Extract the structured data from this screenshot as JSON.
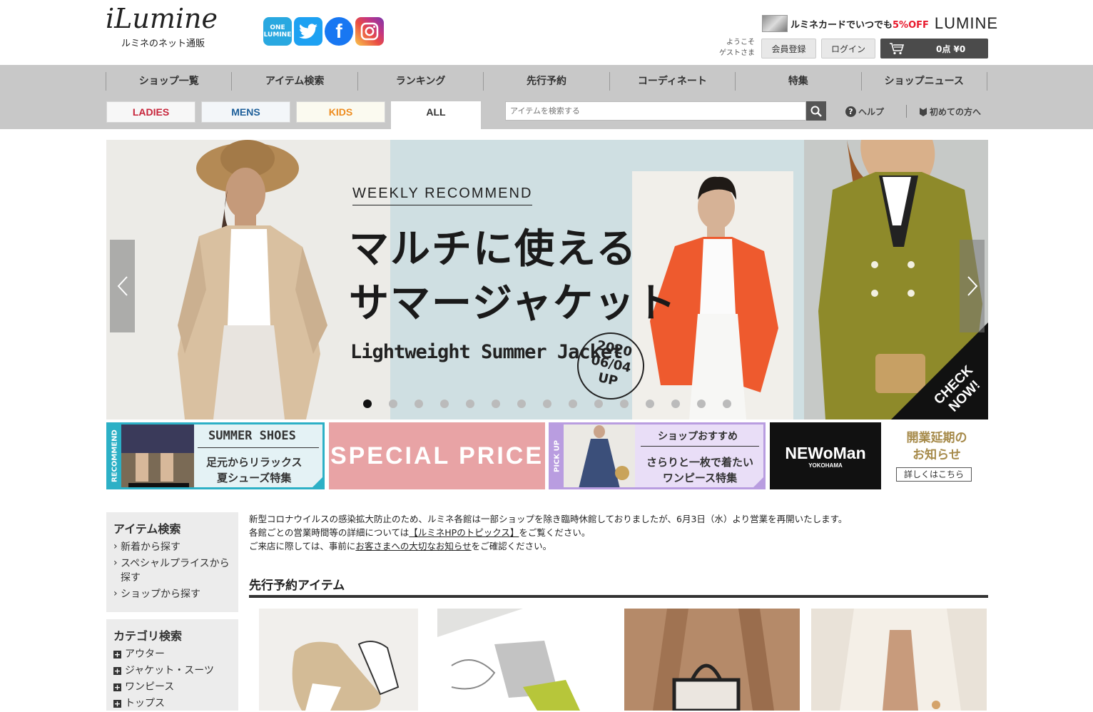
{
  "header": {
    "logo": "iLumine",
    "logo_sub": "ルミネのネット通販",
    "social": {
      "one_lumine": "ONE LUMINE"
    },
    "promo_text_pre": "ルミネカードでいつでも",
    "promo_text_off": "5%OFF",
    "promo_brand": "LUMINE",
    "welcome_line1": "ようこそ",
    "welcome_line2": "ゲストさま",
    "register": "会員登録",
    "login": "ログイン",
    "cart": "0点 ¥0"
  },
  "nav": {
    "items": [
      "ショップ一覧",
      "アイテム検索",
      "ランキング",
      "先行予約",
      "コーディネート",
      "特集",
      "ショップニュース"
    ],
    "tabs": {
      "ladies": "LADIES",
      "mens": "MENS",
      "kids": "KIDS",
      "all": "ALL"
    },
    "search_placeholder": "アイテムを検索する",
    "help": "ヘルプ",
    "first_time": "初めての方へ"
  },
  "hero": {
    "weekly": "WEEKLY RECOMMEND",
    "headline1": "マルチに使える",
    "headline2": "サマージャケット",
    "subline": "Lightweight Summer Jacket",
    "date_year": "2020",
    "date_day": "06/04",
    "date_up": "UP",
    "check1": "CHECK",
    "check2": "NOW!",
    "dot_count": 15,
    "active_dot": 1
  },
  "banners": {
    "b1_vert": "RECOMMEND",
    "b1_title": "SUMMER SHOES",
    "b1_line1": "足元からリラックス",
    "b1_line2": "夏シューズ特集",
    "b2_title": "SPECIAL PRICE",
    "b3_vert": "PICK UP",
    "b3_title": "ショップおすすめ",
    "b3_line1": "さらりと一枚で着たい",
    "b3_line2": "ワンピース特集",
    "b4_title": "NEWoMan",
    "b4_sub": "YOKOHAMA",
    "b5_line1": "開業延期の",
    "b5_line2": "お知らせ",
    "b5_btn": "詳しくはこちら"
  },
  "sidebar": {
    "item_search_title": "アイテム検索",
    "item_links": [
      "新着から探す",
      "スペシャルプライスから探す",
      "ショップから探す"
    ],
    "category_title": "カテゴリ検索",
    "categories": [
      "アウター",
      "ジャケット・スーツ",
      "ワンピース",
      "トップス"
    ]
  },
  "notice": {
    "line1": "新型コロナウイルスの感染拡大防止のため、ルミネ各館は一部ショップを除き臨時休館しておりましたが、6月3日（水）より営業を再開いたします。",
    "line2_pre": "各館ごとの営業時間等の詳細については",
    "line2_link": "【ルミネHPのトピックス】",
    "line2_post": "をご覧ください。",
    "line3_pre": "ご来店に際しては、事前に",
    "line3_link": "お客さまへの大切なお知らせ",
    "line3_post": "をご確認ください。"
  },
  "section": {
    "preorder_title": "先行予約アイテム"
  },
  "colors": {
    "ladies": "#c7243a",
    "mens": "#1d5f9a",
    "kids": "#ee8c1f",
    "promo_red": "#e8192c",
    "nav_bg": "#c8c8c8"
  }
}
